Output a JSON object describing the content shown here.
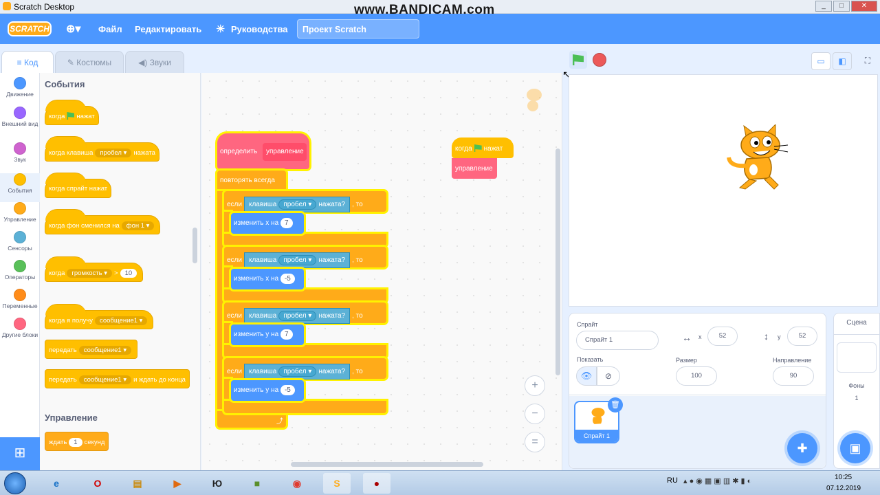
{
  "window": {
    "title": "Scratch Desktop",
    "watermark": "www.BANDICAM.com",
    "controls": [
      "_",
      "□",
      "✕"
    ]
  },
  "menu": {
    "logo": "SCRATCH",
    "file": "Файл",
    "edit": "Редактировать",
    "tutorials": "Руководства",
    "project_title": "Проект Scratch"
  },
  "tabs": {
    "code": "Код",
    "costumes": "Костюмы",
    "sounds": "Звуки"
  },
  "categories": [
    {
      "label": "Движение",
      "color": "#4c97ff"
    },
    {
      "label": "Внешний вид",
      "color": "#9966ff"
    },
    {
      "label": "Звук",
      "color": "#cf63cf"
    },
    {
      "label": "События",
      "color": "#ffbf00"
    },
    {
      "label": "Управление",
      "color": "#ffab19"
    },
    {
      "label": "Сенсоры",
      "color": "#5cb1d6"
    },
    {
      "label": "Операторы",
      "color": "#59c059"
    },
    {
      "label": "Переменные",
      "color": "#ff8c1a"
    },
    {
      "label": "Другие блоки",
      "color": "#ff6680"
    }
  ],
  "palette": {
    "events_heading": "События",
    "when_flag": {
      "a": "когда",
      "b": "нажат"
    },
    "when_key": {
      "a": "когда клавиша",
      "key": "пробел ▾",
      "b": "нажата"
    },
    "when_sprite_clicked": "когда спрайт нажат",
    "when_backdrop": {
      "a": "когда фон сменился на",
      "val": "фон 1 ▾"
    },
    "when_loudness": {
      "a": "когда",
      "val": "громкость ▾",
      "op": ">",
      "num": "10"
    },
    "when_receive": {
      "a": "когда я получу",
      "val": "сообщение1 ▾"
    },
    "broadcast": {
      "a": "передать",
      "val": "сообщение1 ▾"
    },
    "broadcast_wait": {
      "a": "передать",
      "val": "сообщение1 ▾",
      "b": "и ждать до конца"
    },
    "control_heading": "Управление",
    "wait": {
      "a": "ждать",
      "num": "1",
      "b": "секунд"
    }
  },
  "script": {
    "define": "определить",
    "define_name": "управление",
    "forever": "повторять всегда",
    "ifs": [
      {
        "if": "если",
        "key_label": "клавиша",
        "key": "пробел ▾",
        "pressed": "нажата?",
        "then": ", то",
        "action": "изменить х на",
        "val": "7"
      },
      {
        "if": "если",
        "key_label": "клавиша",
        "key": "пробел ▾",
        "pressed": "нажата?",
        "then": ", то",
        "action": "изменить х на",
        "val": "-5"
      },
      {
        "if": "если",
        "key_label": "клавиша",
        "key": "пробел ▾",
        "pressed": "нажата?",
        "then": ", то",
        "action": "изменить у на",
        "val": "7"
      },
      {
        "if": "если",
        "key_label": "клавиша",
        "key": "пробел ▾",
        "pressed": "нажата?",
        "then": ", то",
        "action": "изменить у на",
        "val": "-5"
      }
    ],
    "loop_arrow": "⤴",
    "second": {
      "when": "когда",
      "clicked": "нажат",
      "call": "управление"
    }
  },
  "zoom": {
    "in": "+",
    "out": "−",
    "reset": "="
  },
  "sprite": {
    "label": "Спрайт",
    "name": "Спрайт 1",
    "x_label": "x",
    "x": "52",
    "y_label": "y",
    "y": "52",
    "show_label": "Показать",
    "size_label": "Размер",
    "size": "100",
    "dir_label": "Направление",
    "dir": "90",
    "thumb_name": "Спрайт 1"
  },
  "stage_panel": {
    "title": "Сцена",
    "backdrops_label": "Фоны",
    "backdrops_count": "1"
  },
  "taskbar": {
    "lang": "RU",
    "time": "10:25",
    "date": "07.12.2019"
  }
}
